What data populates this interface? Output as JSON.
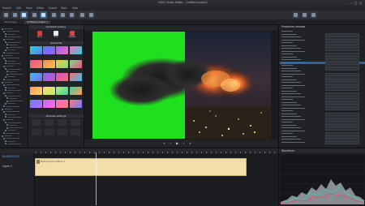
{
  "window": {
    "title": "VSDC Video Editor - Untitled project"
  },
  "menu": {
    "items": [
      "Project",
      "Edit",
      "View",
      "Editor",
      "Export",
      "Tools",
      "Help"
    ]
  },
  "toolbar": {
    "groups": [
      "Projects",
      "Scenes",
      "Layouts",
      "Templates"
    ]
  },
  "tabs": [
    {
      "label": "Start page"
    },
    {
      "label": "Untitled project 1"
    }
  ],
  "gradient_panel": {
    "header": "Gradient Gallery",
    "buttons": [
      {
        "label": "New"
      },
      {
        "label": "Edit"
      },
      {
        "label": "Delete"
      }
    ],
    "section2": "Gradients",
    "section3": "Preview settings",
    "swatch_colors": [
      [
        "#2fd1d6",
        "#5a7df2",
        "#9d5bf0",
        "#f06fc1"
      ],
      [
        "#f24f8f",
        "#f08a4f",
        "#f6c64a",
        "#7be07a"
      ],
      [
        "#3ac0f0",
        "#7b6cf4",
        "#d44ec9",
        "#ff6b6b"
      ],
      [
        "#ff9a5a",
        "#ffd86a",
        "#b3f06b",
        "#43d0a0"
      ],
      [
        "#6a7cff",
        "#c06bff",
        "#ff6bd5",
        "#ff7a7a"
      ]
    ]
  },
  "timeline": {
    "clip_label": "Background effect 1",
    "track_label": "Layer 1",
    "timecode": "00:00:05.017"
  },
  "properties": {
    "title": "Properties window",
    "selected_row": 11
  },
  "scopes": {
    "title": "Waveform"
  },
  "colors": {
    "accent": "#3b5f86",
    "chroma_green": "#1fe01f",
    "clip": "#f3deaa"
  }
}
